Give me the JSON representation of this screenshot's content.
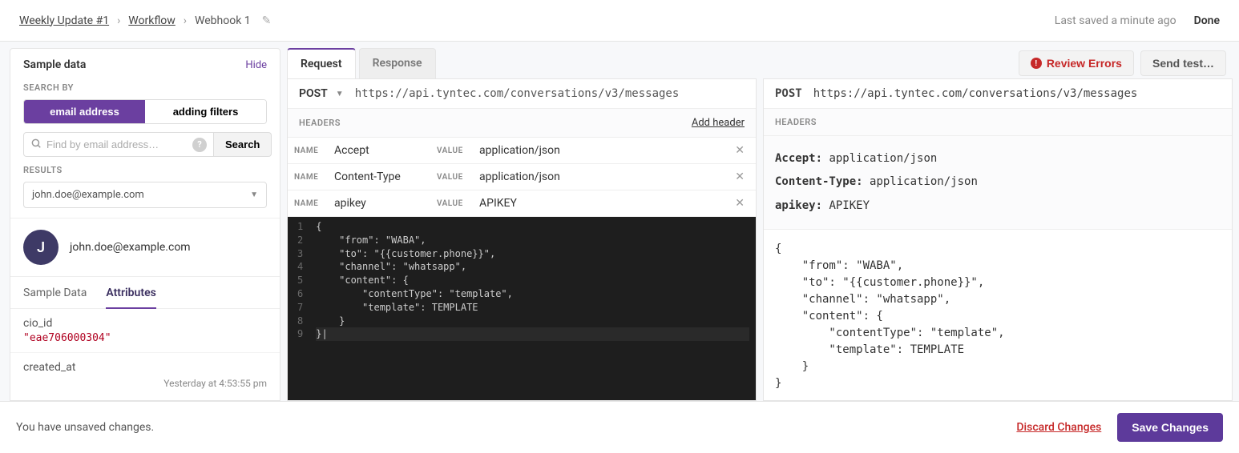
{
  "breadcrumbs": {
    "root": "Weekly Update #1",
    "mid": "Workflow",
    "current": "Webhook 1"
  },
  "top": {
    "last_saved": "Last saved a minute ago",
    "done": "Done"
  },
  "sidebar": {
    "title": "Sample data",
    "hide": "Hide",
    "search_by_label": "SEARCH BY",
    "toggle_email": "email address",
    "toggle_filters": "adding filters",
    "search_placeholder": "Find by email address…",
    "search_btn": "Search",
    "results_label": "RESULTS",
    "selected_result": "john.doe@example.com",
    "avatar_letter": "J",
    "profile_email": "john.doe@example.com",
    "tab_sample_data": "Sample Data",
    "tab_attributes": "Attributes",
    "attrs": [
      {
        "key": "cio_id",
        "value": "\"eae706000304\""
      },
      {
        "key": "created_at",
        "date": "Yesterday at 4:53:55 pm"
      }
    ]
  },
  "center": {
    "tabs": {
      "request": "Request",
      "response": "Response"
    },
    "review_errors": "Review Errors",
    "send_test": "Send test…",
    "request": {
      "method": "POST",
      "url": "https://api.tyntec.com/conversations/v3/messages",
      "headers_label": "HEADERS",
      "add_header": "Add header",
      "name_label": "NAME",
      "value_label": "VALUE",
      "headers": [
        {
          "name": "Accept",
          "value": "application/json"
        },
        {
          "name": "Content-Type",
          "value": "application/json"
        },
        {
          "name": "apikey",
          "value": "APIKEY"
        }
      ],
      "body_lines": [
        "{",
        "    \"from\": \"WABA\",",
        "    \"to\": \"{{customer.phone}}\",",
        "    \"channel\": \"whatsapp\",",
        "    \"content\": {",
        "        \"contentType\": \"template\",",
        "        \"template\": TEMPLATE",
        "    }",
        "}"
      ]
    },
    "response": {
      "method": "POST",
      "url": "https://api.tyntec.com/conversations/v3/messages",
      "headers_label": "HEADERS",
      "headers": [
        {
          "key": "Accept:",
          "value": "application/json"
        },
        {
          "key": "Content-Type:",
          "value": "application/json"
        },
        {
          "key": "apikey:",
          "value": "APIKEY"
        }
      ],
      "body": "{\n    \"from\": \"WABA\",\n    \"to\": \"{{customer.phone}}\",\n    \"channel\": \"whatsapp\",\n    \"content\": {\n        \"contentType\": \"template\",\n        \"template\": TEMPLATE\n    }\n}"
    }
  },
  "footer": {
    "unsaved": "You have unsaved changes.",
    "discard": "Discard Changes",
    "save": "Save Changes"
  }
}
